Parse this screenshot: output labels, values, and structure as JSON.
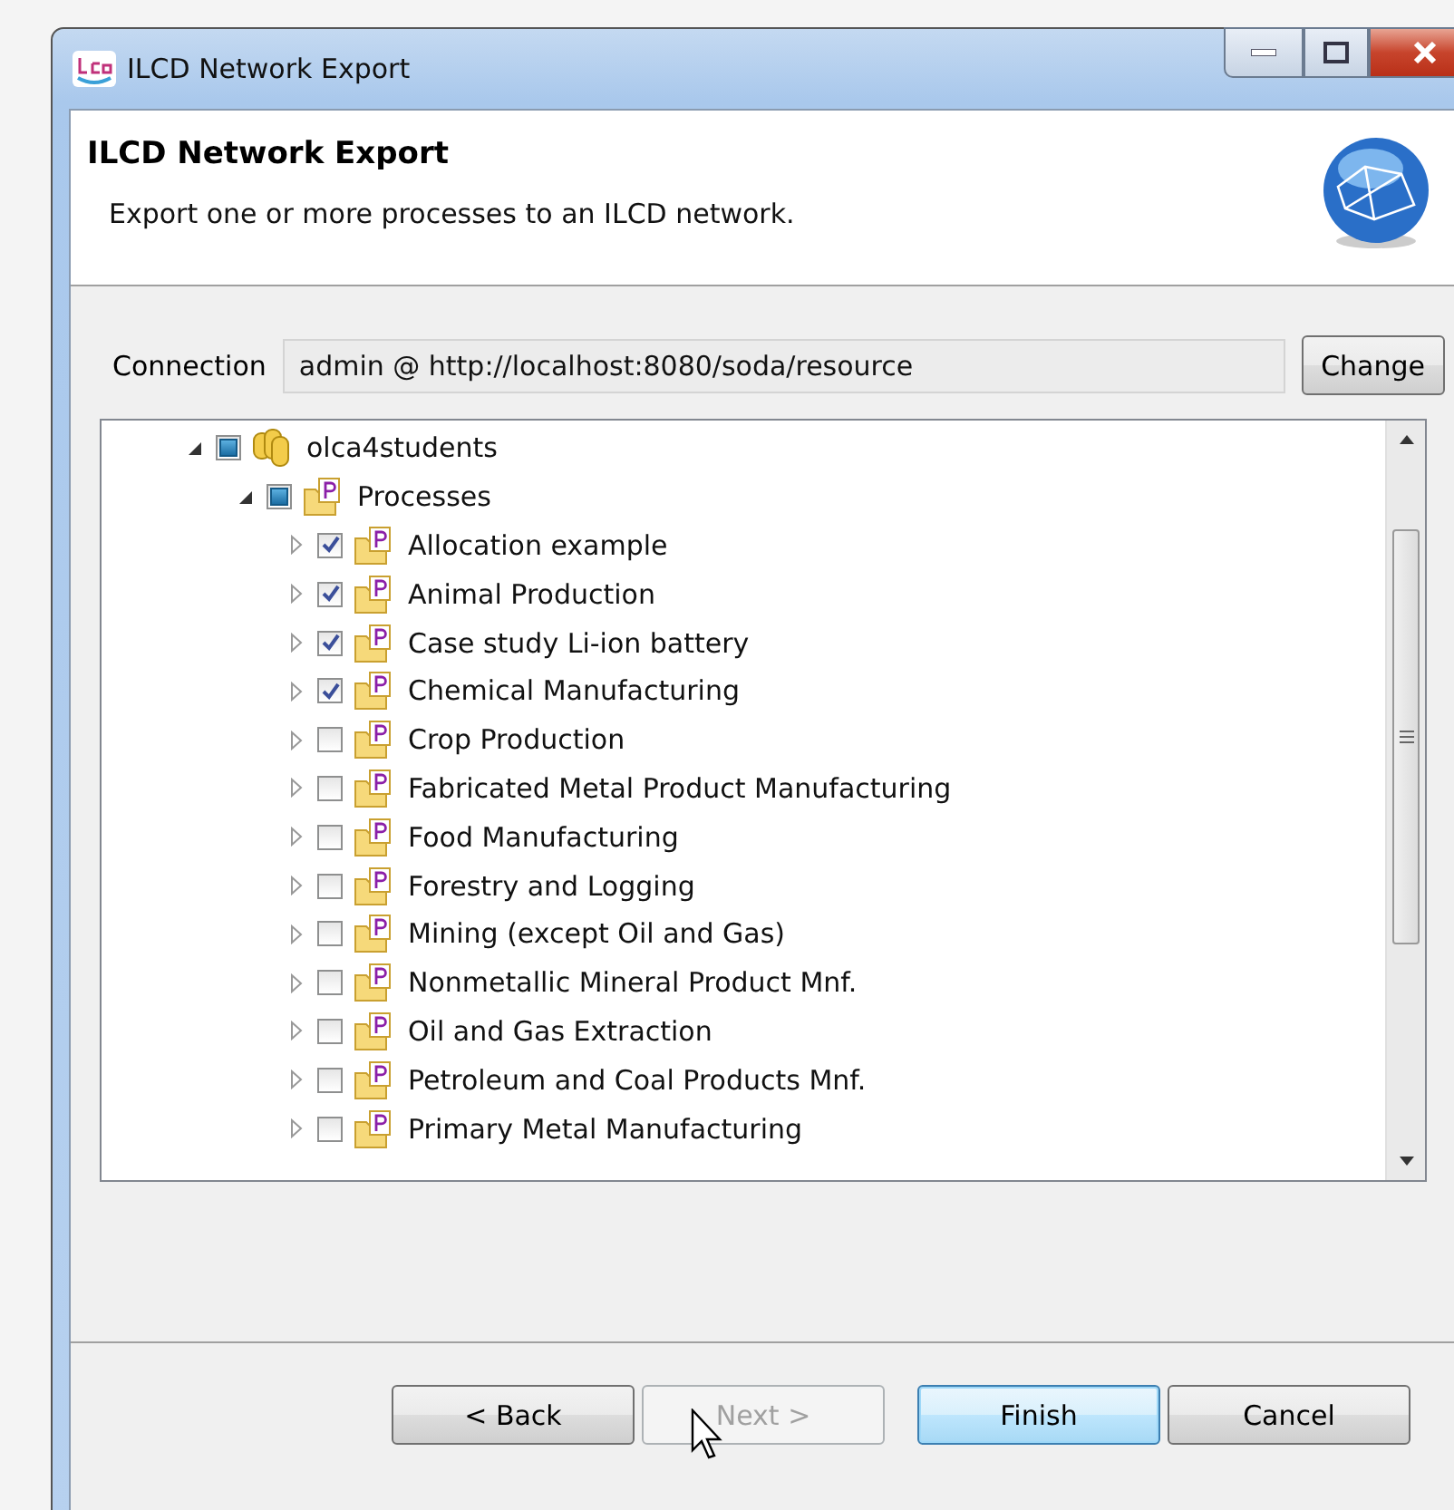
{
  "window": {
    "title": "ILCD Network Export"
  },
  "header": {
    "title": "ILCD Network Export",
    "description": "Export one or more processes to an ILCD network."
  },
  "connection": {
    "label": "Connection",
    "value": "admin @ http://localhost:8080/soda/resource",
    "button": "Change"
  },
  "tree": [
    {
      "kind": "database",
      "label": "olca4students",
      "expanded": true,
      "partial": true,
      "children": [
        {
          "kind": "folder",
          "label": "Processes",
          "expanded": true,
          "partial": true,
          "children": [
            {
              "kind": "folder",
              "label": "Allocation example",
              "expanded": false,
              "checked": true
            },
            {
              "kind": "folder",
              "label": "Animal Production",
              "expanded": false,
              "checked": true
            },
            {
              "kind": "folder",
              "label": "Case study Li-ion battery",
              "expanded": false,
              "checked": true
            },
            {
              "kind": "folder",
              "label": "Chemical Manufacturing",
              "expanded": false,
              "checked": true
            },
            {
              "kind": "folder",
              "label": "Crop Production",
              "expanded": false,
              "checked": false
            },
            {
              "kind": "folder",
              "label": "Fabricated Metal Product Manufacturing",
              "expanded": false,
              "checked": false
            },
            {
              "kind": "folder",
              "label": "Food Manufacturing",
              "expanded": false,
              "checked": false
            },
            {
              "kind": "folder",
              "label": "Forestry and Logging",
              "expanded": false,
              "checked": false
            },
            {
              "kind": "folder",
              "label": "Mining (except Oil and Gas)",
              "expanded": false,
              "checked": false
            },
            {
              "kind": "folder",
              "label": "Nonmetallic Mineral Product Mnf.",
              "expanded": false,
              "checked": false
            },
            {
              "kind": "folder",
              "label": "Oil and Gas Extraction",
              "expanded": false,
              "checked": false
            },
            {
              "kind": "folder",
              "label": "Petroleum and Coal Products Mnf.",
              "expanded": false,
              "checked": false
            },
            {
              "kind": "folder",
              "label": "Primary Metal Manufacturing",
              "expanded": false,
              "checked": false
            }
          ]
        }
      ]
    }
  ],
  "buttons": [
    {
      "label": "< Back",
      "disabled": false,
      "default": false
    },
    {
      "label": "Next >",
      "disabled": true,
      "default": false
    },
    {
      "label": "Finish",
      "disabled": false,
      "default": true
    },
    {
      "label": "Cancel",
      "disabled": false,
      "default": false
    }
  ]
}
